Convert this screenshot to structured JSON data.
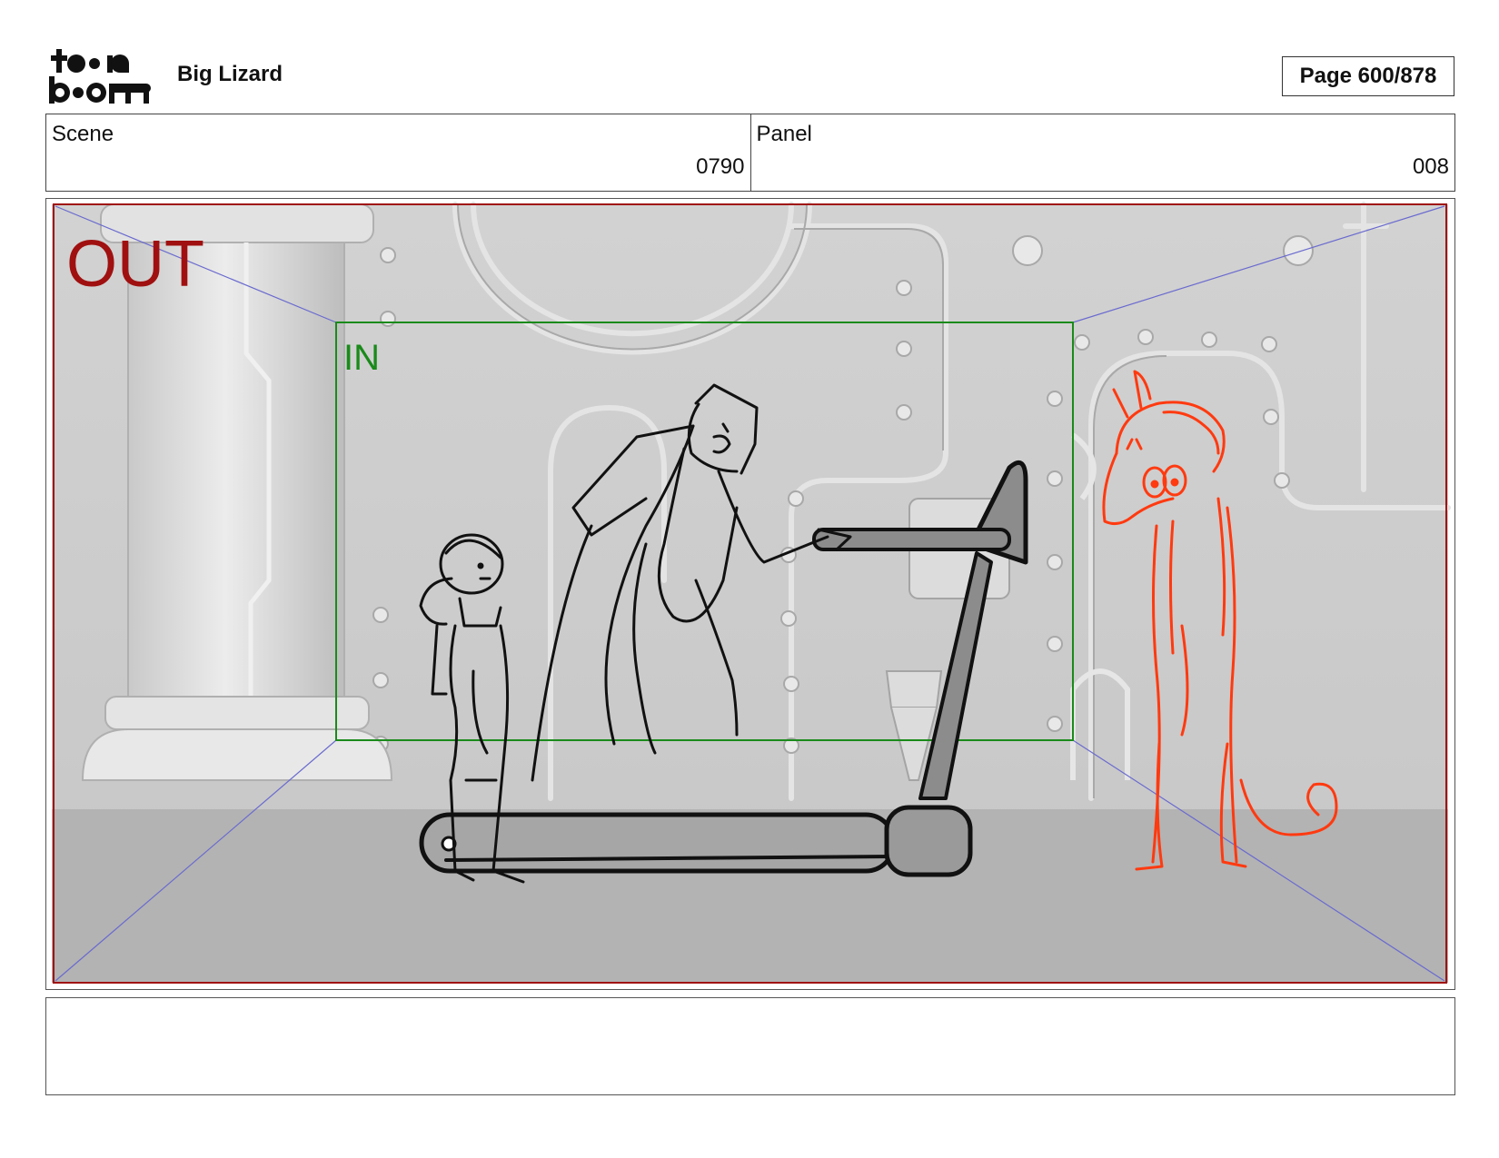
{
  "header": {
    "logo_text": "toon boom",
    "project_title": "Big Lizard",
    "page_label": "Page 600/878"
  },
  "info": {
    "scene_label": "Scene",
    "scene_value": "0790",
    "panel_label": "Panel",
    "panel_value": "008"
  },
  "frame": {
    "out_label": "OUT",
    "in_label": "IN",
    "colors": {
      "out": "#a01010",
      "in": "#1a8a1a",
      "diagonals": "#6a6ad0",
      "red_character": "#ff3a10"
    }
  },
  "notes": {
    "text": ""
  }
}
